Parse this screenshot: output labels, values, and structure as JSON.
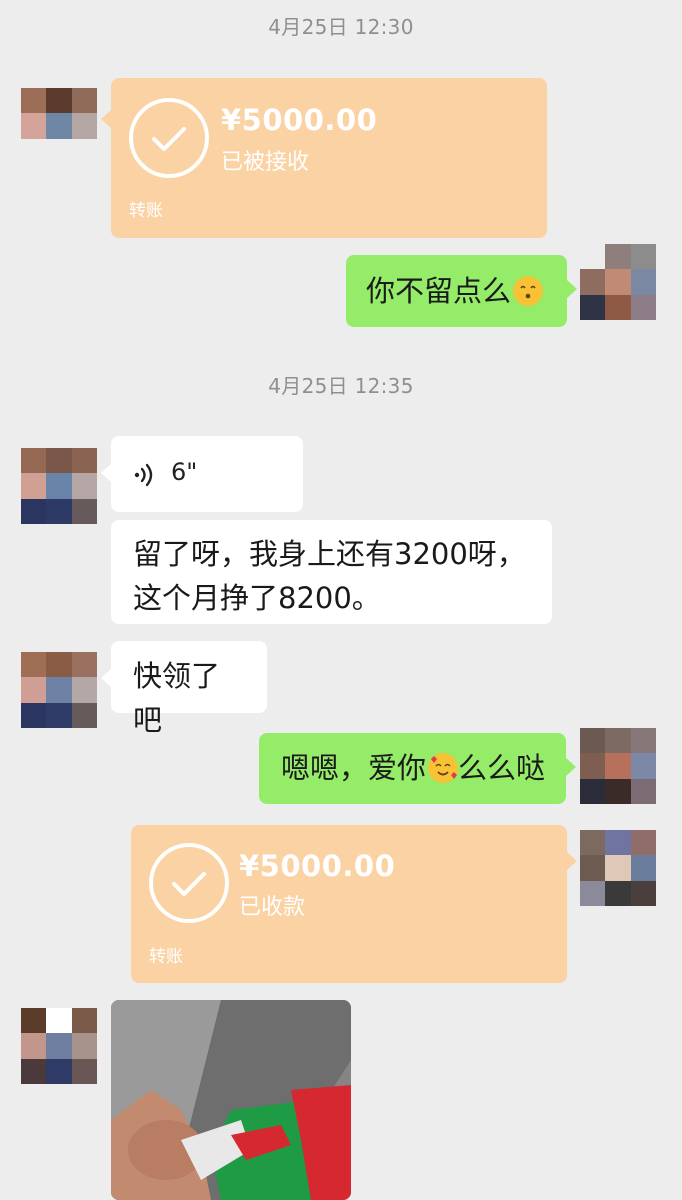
{
  "timestamps": [
    "4月25日 12:30",
    "4月25日 12:35"
  ],
  "transfers": [
    {
      "amount": "¥5000.00",
      "status": "已被接收",
      "label": "转账"
    },
    {
      "amount": "¥5000.00",
      "status": "已收款",
      "label": "转账"
    }
  ],
  "messages": {
    "m1": "你不留点么",
    "voice_duration": "6\"",
    "m2": "留了呀，我身上还有3200呀，\n这个月挣了8200。",
    "m3": "快领了吧",
    "m4_a": "嗯嗯，爱你",
    "m4_b": "么么哒"
  },
  "colors": {
    "background": "#ededed",
    "green_bubble": "#95ec69",
    "white_bubble": "#ffffff",
    "transfer_card": "#fbd2a3",
    "timestamp_text": "#8f8f8f"
  },
  "icons": [
    "check-circle-icon",
    "voice-icon",
    "kissing-emoji-icon",
    "smiling-hearts-emoji-icon"
  ]
}
